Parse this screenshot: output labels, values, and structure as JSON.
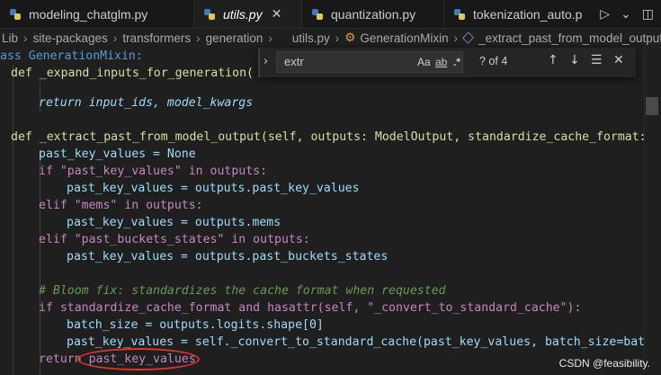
{
  "tabs": [
    {
      "label": "modeling_chatglm.py",
      "active": false
    },
    {
      "label": "utils.py",
      "active": true
    },
    {
      "label": "quantization.py",
      "active": false
    },
    {
      "label": "tokenization_auto.p",
      "active": false
    }
  ],
  "tab_close_glyph": "✕",
  "breadcrumb": [
    "Lib",
    "site-packages",
    "transformers",
    "generation",
    "utils.py",
    "GenerationMixin",
    "_extract_past_from_model_output"
  ],
  "find_widget": {
    "query": "extr",
    "match_case": "Aa",
    "whole_word": "ab",
    "regex": ".*",
    "count": "? of 4"
  },
  "code_lines": [
    "ass GenerationMixin:",
    "def _expand_inputs_for_generation(",
    "return input_ids, model_kwargs",
    "def _extract_past_from_model_output(self, outputs: ModelOutput, standardize_cache_format: bool",
    "past_key_values = None",
    "if \"past_key_values\" in outputs:",
    "past_key_values = outputs.past_key_values",
    "elif \"mems\" in outputs:",
    "past_key_values = outputs.mems",
    "elif \"past_buckets_states\" in outputs:",
    "past_key_values = outputs.past_buckets_states",
    "# Bloom fix: standardizes the cache format when requested",
    "if standardize_cache_format and hasattr(self, \"_convert_to_standard_cache\"):",
    "batch_size = outputs.logits.shape[0]",
    "past_key_values = self._convert_to_standard_cache(past_key_values, batch_size=batch_si",
    "return past_key_values"
  ],
  "watermark": "CSDN @feasibility.",
  "colors": {
    "keyword": "#569cd6",
    "control": "#c586c0",
    "function": "#dcdcaa",
    "class": "#4ec9b0",
    "string": "#ce9178",
    "variable": "#9cdcfe",
    "comment": "#6a9955",
    "annotation": "#e0322b"
  }
}
